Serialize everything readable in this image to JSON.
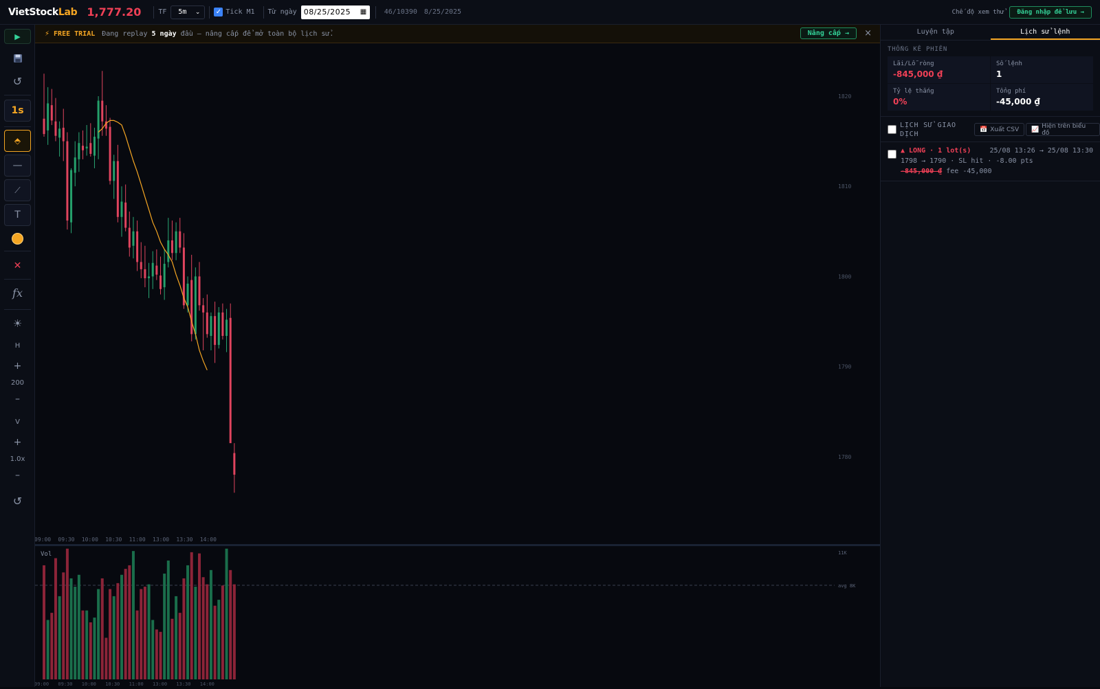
{
  "header": {
    "logo_main": "VietStock",
    "logo_accent": "Lab",
    "price": "1,777.20",
    "tf_label": "TF",
    "tf_value": "5m",
    "tick_label": "Tick M1",
    "from_label": "Từ ngày",
    "date_value": "08/25/2025",
    "counter": "46/10390",
    "current_date": "8/25/2025",
    "guest_mode": "Chế độ xem thử",
    "login_label": "Đăng nhập để lưu →"
  },
  "toolbar": {
    "speed_label": "1s",
    "h_label": "H",
    "h_value": "200",
    "v_label": "V",
    "v_value": "1.0x",
    "fx_label": "fx",
    "color": "#f5a623"
  },
  "banner": {
    "badge": "FREE TRIAL",
    "msg_prefix": "Đang replay",
    "msg_bold": "5 ngày",
    "msg_suffix": "đầu — nâng cấp để mở toàn bộ lịch sử.",
    "upgrade_label": "Nâng cấp →",
    "close": "×"
  },
  "panel": {
    "tabs": [
      "Luyện tập",
      "Lịch sử lệnh"
    ],
    "session_title": "THỐNG KÊ PHIÊN",
    "stats": [
      {
        "label": "Lãi/Lỗ ròng",
        "value": "-845,000 ₫"
      },
      {
        "label": "Số lệnh",
        "value": "1"
      },
      {
        "label": "Tỷ lệ thắng",
        "value": "0%"
      },
      {
        "label": "Tổng phí",
        "value": "-45,000 ₫"
      }
    ],
    "history_title": "LỊCH SỬ GIAO DỊCH",
    "export_label": "Xuất CSV",
    "show_chart_label": "Hiện trên biểu đồ",
    "trade": {
      "side": "▲ LONG · 1 lot(s)",
      "time": "25/08 13:26 → 25/08 13:30",
      "detail": "1798 → 1790 · SL hit · -8.00 pts",
      "pnl": "-845,000 ₫",
      "fee": "fee -45,000"
    }
  },
  "chart_data": {
    "type": "candlestick",
    "x_ticks": [
      "09:00",
      "09:30",
      "10:00",
      "10:30",
      "11:00",
      "13:00",
      "13:30",
      "14:00"
    ],
    "y_ticks": [
      1820,
      1810,
      1800,
      1790,
      1780
    ],
    "vol_label": "Vol",
    "vol_max_label": "11K",
    "vol_avg_label": "avg 8K",
    "up_color": "#1f8f5f",
    "down_color": "#c8324a",
    "ma_color": "#f5a623",
    "candles": [
      {
        "o": 1817.5,
        "h": 1822.5,
        "l": 1815.5,
        "c": 1815.8,
        "v": 9.6
      },
      {
        "o": 1816.2,
        "h": 1821.0,
        "l": 1814.6,
        "c": 1819.2,
        "v": 5.0
      },
      {
        "o": 1819.0,
        "h": 1820.8,
        "l": 1816.8,
        "c": 1817.3,
        "v": 5.6
      },
      {
        "o": 1817.2,
        "h": 1819.8,
        "l": 1815.0,
        "c": 1815.6,
        "v": 10.2
      },
      {
        "o": 1815.4,
        "h": 1817.2,
        "l": 1813.3,
        "c": 1816.4,
        "v": 7.0
      },
      {
        "o": 1816.5,
        "h": 1818.6,
        "l": 1812.8,
        "c": 1815.0,
        "v": 9.0
      },
      {
        "o": 1815.0,
        "h": 1816.0,
        "l": 1805.2,
        "c": 1806.2,
        "v": 11.0
      },
      {
        "o": 1806.0,
        "h": 1812.0,
        "l": 1804.8,
        "c": 1811.8,
        "v": 8.5
      },
      {
        "o": 1811.5,
        "h": 1815.0,
        "l": 1810.0,
        "c": 1813.2,
        "v": 7.8
      },
      {
        "o": 1813.0,
        "h": 1816.0,
        "l": 1811.6,
        "c": 1814.8,
        "v": 8.8
      },
      {
        "o": 1814.5,
        "h": 1816.2,
        "l": 1813.0,
        "c": 1814.0,
        "v": 5.8
      },
      {
        "o": 1814.2,
        "h": 1816.8,
        "l": 1813.4,
        "c": 1814.4,
        "v": 5.8
      },
      {
        "o": 1814.8,
        "h": 1817.0,
        "l": 1813.3,
        "c": 1813.6,
        "v": 4.8
      },
      {
        "o": 1813.4,
        "h": 1816.5,
        "l": 1812.0,
        "c": 1815.5,
        "v": 5.2
      },
      {
        "o": 1815.3,
        "h": 1820.0,
        "l": 1813.0,
        "c": 1819.5,
        "v": 7.6
      },
      {
        "o": 1819.5,
        "h": 1822.8,
        "l": 1815.6,
        "c": 1817.2,
        "v": 8.5
      },
      {
        "o": 1817.2,
        "h": 1819.0,
        "l": 1815.6,
        "c": 1816.4,
        "v": 3.5
      },
      {
        "o": 1816.6,
        "h": 1817.6,
        "l": 1810.2,
        "c": 1810.6,
        "v": 7.6
      },
      {
        "o": 1810.6,
        "h": 1813.5,
        "l": 1808.6,
        "c": 1812.8,
        "v": 7.0
      },
      {
        "o": 1812.8,
        "h": 1814.6,
        "l": 1806.0,
        "c": 1806.6,
        "v": 8.1
      },
      {
        "o": 1806.6,
        "h": 1810.0,
        "l": 1804.4,
        "c": 1808.3,
        "v": 8.8
      },
      {
        "o": 1808.2,
        "h": 1810.2,
        "l": 1805.0,
        "c": 1805.4,
        "v": 9.3
      },
      {
        "o": 1805.4,
        "h": 1807.2,
        "l": 1802.2,
        "c": 1803.2,
        "v": 9.6
      },
      {
        "o": 1803.4,
        "h": 1806.6,
        "l": 1802.0,
        "c": 1805.0,
        "v": 10.8
      },
      {
        "o": 1805.0,
        "h": 1806.2,
        "l": 1800.6,
        "c": 1801.6,
        "v": 5.8
      },
      {
        "o": 1801.6,
        "h": 1803.8,
        "l": 1799.8,
        "c": 1800.8,
        "v": 7.6
      },
      {
        "o": 1800.8,
        "h": 1803.4,
        "l": 1798.8,
        "c": 1799.8,
        "v": 7.8
      },
      {
        "o": 1799.8,
        "h": 1801.5,
        "l": 1797.6,
        "c": 1800.0,
        "v": 8.0
      },
      {
        "o": 1800.0,
        "h": 1802.8,
        "l": 1798.6,
        "c": 1801.5,
        "v": 5.0
      },
      {
        "o": 1801.2,
        "h": 1803.0,
        "l": 1799.6,
        "c": 1800.2,
        "v": 4.2
      },
      {
        "o": 1800.1,
        "h": 1802.2,
        "l": 1798.0,
        "c": 1798.6,
        "v": 4.0
      },
      {
        "o": 1798.8,
        "h": 1803.0,
        "l": 1797.4,
        "c": 1801.4,
        "v": 8.9
      },
      {
        "o": 1801.6,
        "h": 1806.5,
        "l": 1801.0,
        "c": 1804.0,
        "v": 10.0
      },
      {
        "o": 1804.0,
        "h": 1806.2,
        "l": 1801.8,
        "c": 1802.6,
        "v": 5.1
      },
      {
        "o": 1802.6,
        "h": 1806.0,
        "l": 1801.8,
        "c": 1805.0,
        "v": 7.0
      },
      {
        "o": 1805.0,
        "h": 1806.5,
        "l": 1802.6,
        "c": 1803.2,
        "v": 5.6
      },
      {
        "o": 1803.2,
        "h": 1804.8,
        "l": 1796.4,
        "c": 1796.8,
        "v": 8.5
      },
      {
        "o": 1796.8,
        "h": 1800.0,
        "l": 1796.0,
        "c": 1799.2,
        "v": 9.6
      },
      {
        "o": 1799.6,
        "h": 1802.4,
        "l": 1792.8,
        "c": 1793.6,
        "v": 10.7
      },
      {
        "o": 1793.6,
        "h": 1801.0,
        "l": 1793.0,
        "c": 1800.0,
        "v": 7.8
      },
      {
        "o": 1800.0,
        "h": 1801.6,
        "l": 1796.2,
        "c": 1796.8,
        "v": 10.6
      },
      {
        "o": 1796.8,
        "h": 1797.6,
        "l": 1791.8,
        "c": 1796.0,
        "v": 8.6
      },
      {
        "o": 1796.0,
        "h": 1798.0,
        "l": 1793.2,
        "c": 1793.6,
        "v": 8.0
      },
      {
        "o": 1793.4,
        "h": 1796.0,
        "l": 1791.8,
        "c": 1795.6,
        "v": 9.2
      },
      {
        "o": 1795.6,
        "h": 1797.2,
        "l": 1790.4,
        "c": 1792.4,
        "v": 6.2
      },
      {
        "o": 1792.4,
        "h": 1796.6,
        "l": 1792.0,
        "c": 1796.0,
        "v": 6.7
      },
      {
        "o": 1796.0,
        "h": 1797.0,
        "l": 1793.0,
        "c": 1793.4,
        "v": 7.9
      },
      {
        "o": 1793.4,
        "h": 1796.4,
        "l": 1791.6,
        "c": 1795.2,
        "v": 11.0
      },
      {
        "o": 1795.4,
        "h": 1797.0,
        "l": 1791.0,
        "c": 1781.5,
        "v": 9.2
      },
      {
        "o": 1780.4,
        "h": 1781.5,
        "l": 1776.0,
        "c": 1778.0,
        "v": 8.0
      }
    ],
    "ma": [
      1816.0,
      1816.4,
      1817.0,
      1817.3,
      1817.3,
      1817.1,
      1816.8,
      1815.6,
      1814.2,
      1812.8,
      1811.6,
      1810.2,
      1808.8,
      1807.4,
      1806.0,
      1805.0,
      1803.8,
      1803.0,
      1802.4,
      1801.6,
      1800.2,
      1799.0,
      1797.6,
      1796.6,
      1795.0,
      1793.6,
      1791.8,
      1790.6,
      1789.6
    ]
  }
}
